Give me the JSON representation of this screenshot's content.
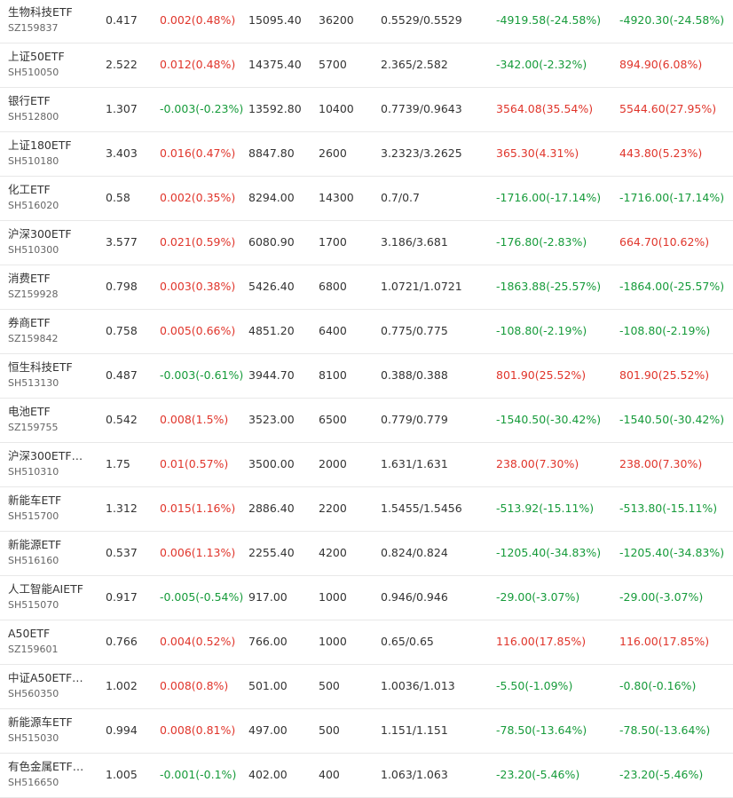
{
  "colors": {
    "up": "#e0352b",
    "down": "#169b3a",
    "text": "#333333",
    "sub_text": "#666666",
    "divider": "#e8e8e8"
  },
  "rows": [
    {
      "name": "生物科技ETF",
      "code": "SZ159837",
      "price": "0.417",
      "change": "0.002(0.48%)",
      "change_dir": "up",
      "value": "15095.40",
      "qty": "36200",
      "cost": "0.5529/0.5529",
      "pnl1": "-4919.58(-24.58%)",
      "pnl1_dir": "down",
      "pnl2": "-4920.30(-24.58%)",
      "pnl2_dir": "down"
    },
    {
      "name": "上证50ETF",
      "code": "SH510050",
      "price": "2.522",
      "change": "0.012(0.48%)",
      "change_dir": "up",
      "value": "14375.40",
      "qty": "5700",
      "cost": "2.365/2.582",
      "pnl1": "-342.00(-2.32%)",
      "pnl1_dir": "down",
      "pnl2": "894.90(6.08%)",
      "pnl2_dir": "up"
    },
    {
      "name": "银行ETF",
      "code": "SH512800",
      "price": "1.307",
      "change": "-0.003(-0.23%)",
      "change_dir": "down",
      "value": "13592.80",
      "qty": "10400",
      "cost": "0.7739/0.9643",
      "pnl1": "3564.08(35.54%)",
      "pnl1_dir": "up",
      "pnl2": "5544.60(27.95%)",
      "pnl2_dir": "up"
    },
    {
      "name": "上证180ETF",
      "code": "SH510180",
      "price": "3.403",
      "change": "0.016(0.47%)",
      "change_dir": "up",
      "value": "8847.80",
      "qty": "2600",
      "cost": "3.2323/3.2625",
      "pnl1": "365.30(4.31%)",
      "pnl1_dir": "up",
      "pnl2": "443.80(5.23%)",
      "pnl2_dir": "up"
    },
    {
      "name": "化工ETF",
      "code": "SH516020",
      "price": "0.58",
      "change": "0.002(0.35%)",
      "change_dir": "up",
      "value": "8294.00",
      "qty": "14300",
      "cost": "0.7/0.7",
      "pnl1": "-1716.00(-17.14%)",
      "pnl1_dir": "down",
      "pnl2": "-1716.00(-17.14%)",
      "pnl2_dir": "down"
    },
    {
      "name": "沪深300ETF",
      "code": "SH510300",
      "price": "3.577",
      "change": "0.021(0.59%)",
      "change_dir": "up",
      "value": "6080.90",
      "qty": "1700",
      "cost": "3.186/3.681",
      "pnl1": "-176.80(-2.83%)",
      "pnl1_dir": "down",
      "pnl2": "664.70(10.62%)",
      "pnl2_dir": "up"
    },
    {
      "name": "消费ETF",
      "code": "SZ159928",
      "price": "0.798",
      "change": "0.003(0.38%)",
      "change_dir": "up",
      "value": "5426.40",
      "qty": "6800",
      "cost": "1.0721/1.0721",
      "pnl1": "-1863.88(-25.57%)",
      "pnl1_dir": "down",
      "pnl2": "-1864.00(-25.57%)",
      "pnl2_dir": "down"
    },
    {
      "name": "券商ETF",
      "code": "SZ159842",
      "price": "0.758",
      "change": "0.005(0.66%)",
      "change_dir": "up",
      "value": "4851.20",
      "qty": "6400",
      "cost": "0.775/0.775",
      "pnl1": "-108.80(-2.19%)",
      "pnl1_dir": "down",
      "pnl2": "-108.80(-2.19%)",
      "pnl2_dir": "down"
    },
    {
      "name": "恒生科技ETF",
      "code": "SH513130",
      "price": "0.487",
      "change": "-0.003(-0.61%)",
      "change_dir": "down",
      "value": "3944.70",
      "qty": "8100",
      "cost": "0.388/0.388",
      "pnl1": "801.90(25.52%)",
      "pnl1_dir": "up",
      "pnl2": "801.90(25.52%)",
      "pnl2_dir": "up"
    },
    {
      "name": "电池ETF",
      "code": "SZ159755",
      "price": "0.542",
      "change": "0.008(1.5%)",
      "change_dir": "up",
      "value": "3523.00",
      "qty": "6500",
      "cost": "0.779/0.779",
      "pnl1": "-1540.50(-30.42%)",
      "pnl1_dir": "down",
      "pnl2": "-1540.50(-30.42%)",
      "pnl2_dir": "down"
    },
    {
      "name": "沪深300ETF…",
      "code": "SH510310",
      "price": "1.75",
      "change": "0.01(0.57%)",
      "change_dir": "up",
      "value": "3500.00",
      "qty": "2000",
      "cost": "1.631/1.631",
      "pnl1": "238.00(7.30%)",
      "pnl1_dir": "up",
      "pnl2": "238.00(7.30%)",
      "pnl2_dir": "up"
    },
    {
      "name": "新能车ETF",
      "code": "SH515700",
      "price": "1.312",
      "change": "0.015(1.16%)",
      "change_dir": "up",
      "value": "2886.40",
      "qty": "2200",
      "cost": "1.5455/1.5456",
      "pnl1": "-513.92(-15.11%)",
      "pnl1_dir": "down",
      "pnl2": "-513.80(-15.11%)",
      "pnl2_dir": "down"
    },
    {
      "name": "新能源ETF",
      "code": "SH516160",
      "price": "0.537",
      "change": "0.006(1.13%)",
      "change_dir": "up",
      "value": "2255.40",
      "qty": "4200",
      "cost": "0.824/0.824",
      "pnl1": "-1205.40(-34.83%)",
      "pnl1_dir": "down",
      "pnl2": "-1205.40(-34.83%)",
      "pnl2_dir": "down"
    },
    {
      "name": "人工智能AIETF",
      "code": "SH515070",
      "price": "0.917",
      "change": "-0.005(-0.54%)",
      "change_dir": "down",
      "value": "917.00",
      "qty": "1000",
      "cost": "0.946/0.946",
      "pnl1": "-29.00(-3.07%)",
      "pnl1_dir": "down",
      "pnl2": "-29.00(-3.07%)",
      "pnl2_dir": "down"
    },
    {
      "name": "A50ETF",
      "code": "SZ159601",
      "price": "0.766",
      "change": "0.004(0.52%)",
      "change_dir": "up",
      "value": "766.00",
      "qty": "1000",
      "cost": "0.65/0.65",
      "pnl1": "116.00(17.85%)",
      "pnl1_dir": "up",
      "pnl2": "116.00(17.85%)",
      "pnl2_dir": "up"
    },
    {
      "name": "中证A50ETF…",
      "code": "SH560350",
      "price": "1.002",
      "change": "0.008(0.8%)",
      "change_dir": "up",
      "value": "501.00",
      "qty": "500",
      "cost": "1.0036/1.013",
      "pnl1": "-5.50(-1.09%)",
      "pnl1_dir": "down",
      "pnl2": "-0.80(-0.16%)",
      "pnl2_dir": "down"
    },
    {
      "name": "新能源车ETF",
      "code": "SH515030",
      "price": "0.994",
      "change": "0.008(0.81%)",
      "change_dir": "up",
      "value": "497.00",
      "qty": "500",
      "cost": "1.151/1.151",
      "pnl1": "-78.50(-13.64%)",
      "pnl1_dir": "down",
      "pnl2": "-78.50(-13.64%)",
      "pnl2_dir": "down"
    },
    {
      "name": "有色金属ETF…",
      "code": "SH516650",
      "price": "1.005",
      "change": "-0.001(-0.1%)",
      "change_dir": "down",
      "value": "402.00",
      "qty": "400",
      "cost": "1.063/1.063",
      "pnl1": "-23.20(-5.46%)",
      "pnl1_dir": "down",
      "pnl2": "-23.20(-5.46%)",
      "pnl2_dir": "down"
    }
  ]
}
